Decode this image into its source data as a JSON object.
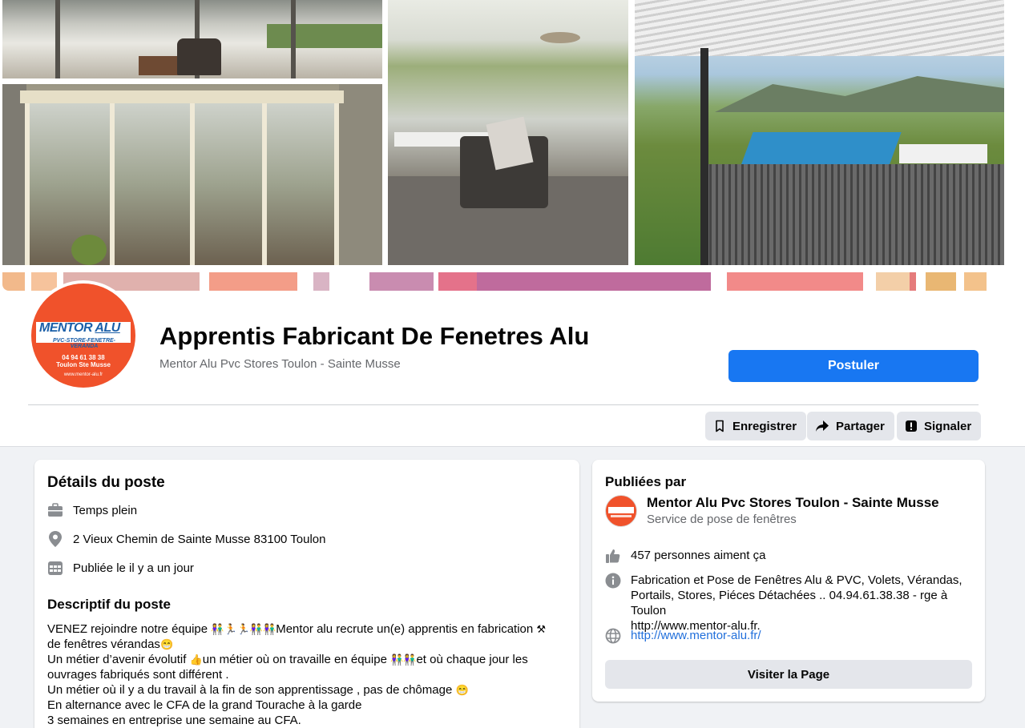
{
  "job": {
    "title": "Apprentis Fabricant De Fenetres Alu",
    "company": "Mentor Alu Pvc Stores Toulon - Sainte Musse",
    "apply_label": "Postuler"
  },
  "logo": {
    "name_main": "MENTOR",
    "name_alu": "ALU",
    "tagline": "PVC-STORE-FENETRE-VERANDA",
    "phone": "04 94 61 38 38",
    "city": "Toulon  Ste Musse",
    "website": "www.mentor-alu.fr"
  },
  "actions": {
    "save_label": "Enregistrer",
    "share_label": "Partager",
    "report_label": "Signaler"
  },
  "details": {
    "heading": "Détails du poste",
    "type": "Temps plein",
    "address": "2 Vieux Chemin de Sainte Musse 83100 Toulon",
    "posted": "Publiée le il y a un jour",
    "desc_heading": "Descriptif du poste",
    "desc_lines": [
      "VENEZ rejoindre notre équipe ",
      "Mentor alu recrute un(e) apprentis en fabrication ",
      "de fenêtres vérandas",
      "Un métier d’avenir évolutif ",
      "un métier où on travaille en équipe ",
      "et où chaque jour les",
      "ouvrages fabriqués sont différent .",
      "Un métier où il y a du travail à la fin de son apprentissage , pas de chômage ",
      "En alternance avec le CFA de la grand Tourache à la garde",
      "3 semaines en entreprise une semaine au CFA."
    ]
  },
  "publisher": {
    "heading": "Publiées par",
    "name": "Mentor Alu Pvc Stores Toulon - Sainte Musse",
    "category": "Service de pose de fenêtres",
    "likes": "457 personnes aiment ça",
    "about_1": "Fabrication et Pose de Fenêtres Alu & PVC, Volets, Vérandas,",
    "about_2": "Portails, Stores, Piéces Détachées .. 04.94.61.38.38 - rge à Toulon",
    "about_3": "http://www.mentor-alu.fr.",
    "website": "http://www.mentor-alu.fr/",
    "visit_label": "Visiter la Page"
  },
  "colors": {
    "primary": "#1877f2",
    "background": "#f0f2f5",
    "logo_orange": "#f0522b",
    "link": "#216fdb"
  },
  "icons": [
    "bookmark-icon",
    "share-icon",
    "report-icon",
    "briefcase-icon",
    "location-pin-icon",
    "calendar-icon",
    "like-icon",
    "info-icon",
    "globe-icon"
  ]
}
